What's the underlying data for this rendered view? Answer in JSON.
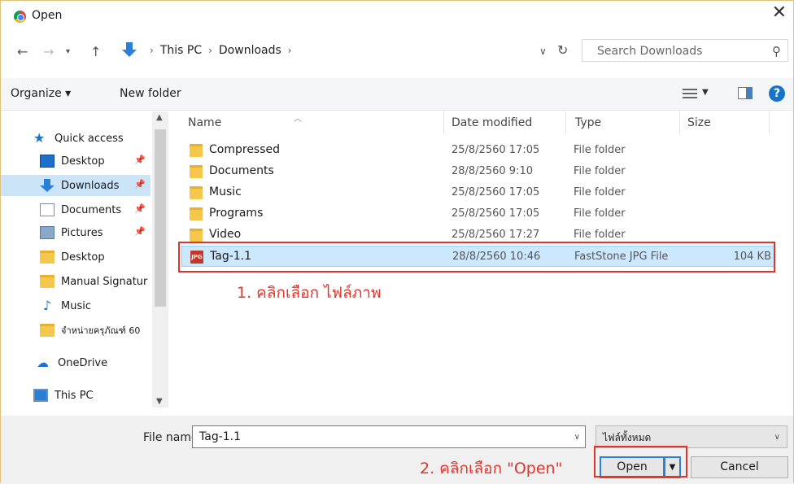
{
  "window": {
    "title": "Open",
    "close": "✕"
  },
  "address": {
    "crumbs": [
      "This PC",
      "Downloads"
    ],
    "search_placeholder": "Search Downloads"
  },
  "toolbar": {
    "organize": "Organize ▾",
    "new_folder": "New folder"
  },
  "sidebar": {
    "items": [
      {
        "label": "Quick access",
        "icon": "star-icon"
      },
      {
        "label": "Desktop",
        "icon": "desktop-icon",
        "pinned": true
      },
      {
        "label": "Downloads",
        "icon": "download-icon",
        "pinned": true,
        "selected": true
      },
      {
        "label": "Documents",
        "icon": "documents-icon",
        "pinned": true
      },
      {
        "label": "Pictures",
        "icon": "pictures-icon",
        "pinned": true
      },
      {
        "label": "Desktop",
        "icon": "folder-icon"
      },
      {
        "label": "Manual Signatur",
        "icon": "folder-icon"
      },
      {
        "label": "Music",
        "icon": "music-icon"
      },
      {
        "label": "จำหน่ายครุภัณฑ์ 60",
        "icon": "folder-icon"
      },
      {
        "label": "OneDrive",
        "icon": "onedrive-icon"
      },
      {
        "label": "This PC",
        "icon": "this-pc-icon"
      }
    ]
  },
  "columns": [
    "Name",
    "Date modified",
    "Type",
    "Size"
  ],
  "files": [
    {
      "name": "Compressed",
      "date": "25/8/2560 17:05",
      "type": "File folder",
      "size": "",
      "icon": "folder-icon"
    },
    {
      "name": "Documents",
      "date": "28/8/2560 9:10",
      "type": "File folder",
      "size": "",
      "icon": "folder-icon"
    },
    {
      "name": "Music",
      "date": "25/8/2560 17:05",
      "type": "File folder",
      "size": "",
      "icon": "folder-icon"
    },
    {
      "name": "Programs",
      "date": "25/8/2560 17:05",
      "type": "File folder",
      "size": "",
      "icon": "folder-icon"
    },
    {
      "name": "Video",
      "date": "25/8/2560 17:27",
      "type": "File folder",
      "size": "",
      "icon": "folder-icon"
    },
    {
      "name": "Tag-1.1",
      "date": "28/8/2560 10:46",
      "type": "FastStone JPG File",
      "size": "104 KB",
      "icon": "jpg-file-icon",
      "selected": true
    }
  ],
  "jpg_badge": "JPG",
  "annotations": {
    "step1": "1. คลิกเลือก ไฟล์ภาพ",
    "step2": "2. คลิกเลือก \"Open\""
  },
  "bottom": {
    "file_name_label": "File name:",
    "file_name_value": "Tag-1.1",
    "file_type_value": "ไฟล์ทั้งหมด",
    "open_label": "Open",
    "cancel_label": "Cancel"
  },
  "colors": {
    "accent": "#1a73c8",
    "annotation": "#e0352b",
    "selection": "#cce8ff"
  }
}
